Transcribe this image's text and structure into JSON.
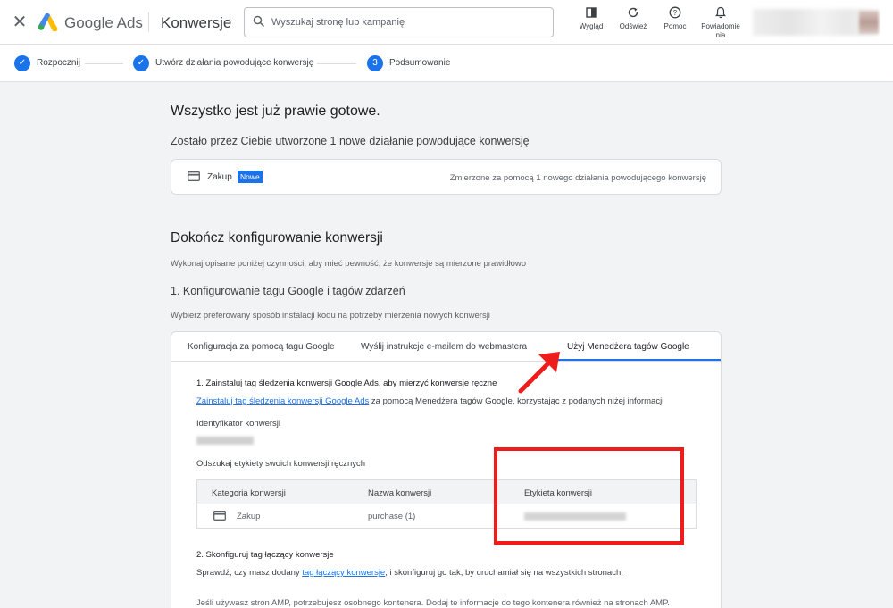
{
  "header": {
    "close_icon": "close-icon",
    "brand": "Google Ads",
    "page_title": "Konwersje",
    "search_placeholder": "Wyszukaj stronę lub kampanię",
    "tools": [
      {
        "icon": "appearance-icon",
        "label": "Wygląd"
      },
      {
        "icon": "refresh-icon",
        "label": "Odśwież"
      },
      {
        "icon": "help-icon",
        "label": "Pomoc"
      },
      {
        "icon": "bell-icon",
        "label_line1": "Powiadomie",
        "label_line2": "nia"
      }
    ]
  },
  "stepper": {
    "steps": [
      {
        "label": "Rozpocznij",
        "state": "done"
      },
      {
        "label": "Utwórz działania powodujące konwersję",
        "state": "done"
      },
      {
        "number": "3",
        "label": "Podsumowanie",
        "state": "current"
      }
    ]
  },
  "summary": {
    "heading": "Wszystko jest już prawie gotowe.",
    "subheading": "Zostało przez Ciebie utworzone 1 nowe działanie powodujące konwersję",
    "card": {
      "name": "Zakup",
      "badge": "Nowe",
      "measured": "Zmierzone za pomocą 1 nowego działania powodującego konwersję"
    }
  },
  "finish": {
    "heading": "Dokończ konfigurowanie konwersji",
    "description": "Wykonaj opisane poniżej czynności, aby mieć pewność, że konwersje są mierzone prawidłowo",
    "section_title": "1. Konfigurowanie tagu Google i tagów zdarzeń",
    "section_desc": "Wybierz preferowany sposób instalacji kodu na potrzeby mierzenia nowych konwersji"
  },
  "tabs": [
    {
      "label": "Konfiguracja za pomocą tagu Google",
      "active": false
    },
    {
      "label": "Wyślij instrukcje e-mailem do webmastera",
      "active": false
    },
    {
      "label": "Użyj Menedżera tagów Google",
      "active": true
    }
  ],
  "gtm": {
    "step1_title": "1. Zainstaluj tag śledzenia konwersji Google Ads, aby mierzyć konwersje ręczne",
    "step1_link": "Zainstaluj tag śledzenia konwersji Google Ads",
    "step1_rest": " za pomocą Menedżera tagów Google, korzystając z podanych niżej informacji",
    "id_label": "Identyfikator konwersji",
    "find_labels": "Odszukaj etykiety swoich konwersji ręcznych",
    "table": {
      "columns": [
        "Kategoria konwersji",
        "Nazwa konwersji",
        "Etykieta konwersji"
      ],
      "rows": [
        {
          "category": "Zakup",
          "name": "purchase (1)"
        }
      ]
    },
    "step2_title": "2. Skonfiguruj tag łączący konwersje",
    "step2_before": "Sprawdź, czy masz dodany ",
    "step2_link": "tag łączący konwersje",
    "step2_after": ", i skonfiguruj go tak, by uruchamiał się na wszystkich stronach.",
    "amp_note": "Jeśli używasz stron AMP, potrzebujesz osobnego kontenera. Dodaj te informacje do tego kontenera również na stronach AMP."
  },
  "colors": {
    "accent": "#1a73e8",
    "annotation": "#ef1c1c"
  }
}
